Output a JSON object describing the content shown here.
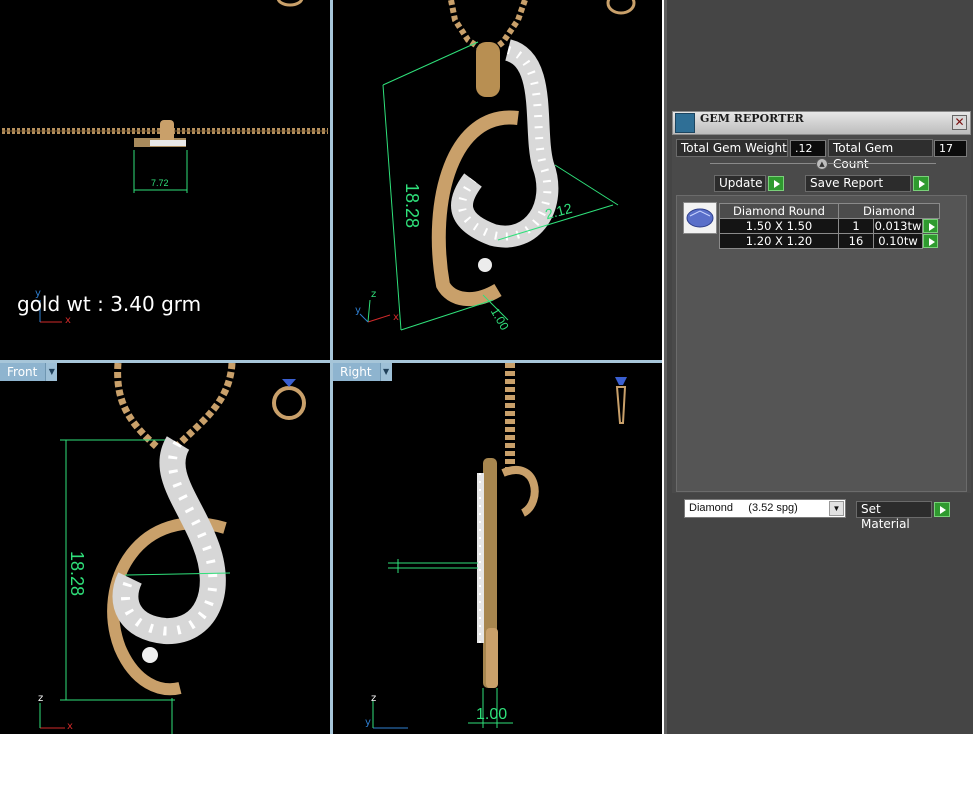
{
  "overlay": {
    "gold_weight_label": "gold wt : 3.40 grm"
  },
  "viewports": {
    "front": {
      "tab_label": "Front",
      "dimension": "18.28"
    },
    "right": {
      "tab_label": "Right",
      "dimension": "1.00"
    },
    "top": {
      "dimension": "7.72"
    },
    "perspective": {
      "dimension_vertical": "18.28",
      "dimension_diag": "2.12",
      "dimension_small": "1.00"
    }
  },
  "axis_labels": {
    "x": "x",
    "y": "y",
    "z": "z"
  },
  "gem_reporter": {
    "title": "GEM REPORTER",
    "close_glyph": "✕",
    "total_weight_label": "Total Gem Weight",
    "total_weight_value": ".12",
    "total_count_label": "Total Gem Count",
    "total_count_value": "17",
    "update_label": "Update",
    "save_report_label": "Save Report",
    "table": {
      "headers": [
        "Diamond Round",
        "Diamond"
      ],
      "rows": [
        {
          "size": "1.50 X 1.50",
          "count": "1",
          "weight": "0.013tw"
        },
        {
          "size": "1.20 X 1.20",
          "count": "16",
          "weight": "0.10tw"
        }
      ]
    }
  },
  "material": {
    "selected": "Diamond     (3.52 spg)",
    "set_material_label": "Set Material"
  },
  "colors": {
    "viewport_bg": "#000000",
    "gold": "#c9a06a",
    "dimension_green": "#2fe07a",
    "panel_bg": "#454545",
    "go_green": "#2f9a2f"
  }
}
